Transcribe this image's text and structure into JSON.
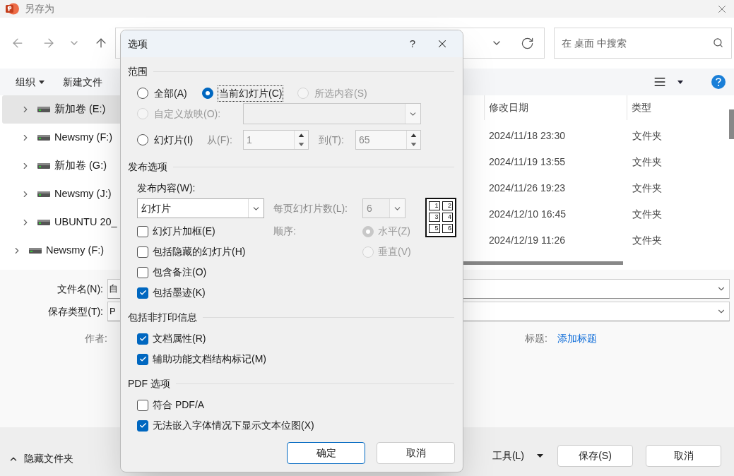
{
  "window": {
    "title": "另存为"
  },
  "navigation": {
    "search_placeholder": "在 桌面 中搜索"
  },
  "toolbar": {
    "organize": "组织",
    "new_folder": "新建文件"
  },
  "nav_pane": [
    {
      "label": "新加卷 (E:)",
      "kind": "child",
      "selected": true
    },
    {
      "label": "Newsmy (F:)",
      "kind": "child",
      "selected": false
    },
    {
      "label": "新加卷 (G:)",
      "kind": "child",
      "selected": false
    },
    {
      "label": "Newsmy (J:)",
      "kind": "child",
      "selected": false
    },
    {
      "label": "UBUNTU 20_",
      "kind": "child",
      "selected": false
    },
    {
      "label": "Newsmy (F:)",
      "kind": "top",
      "selected": false
    }
  ],
  "file_list": {
    "columns": [
      "修改日期",
      "类型"
    ],
    "rows": [
      [
        "2024/11/18 23:30",
        "文件夹"
      ],
      [
        "2024/11/19 13:55",
        "文件夹"
      ],
      [
        "2024/11/26 19:23",
        "文件夹"
      ],
      [
        "2024/12/10 16:45",
        "文件夹"
      ],
      [
        "2024/12/19 11:26",
        "文件夹"
      ]
    ]
  },
  "form": {
    "file_name_label": "文件名(N):",
    "file_name_value": "自",
    "save_type_label": "保存类型(T):",
    "save_type_value": "P",
    "author_label": "作者:",
    "title_label": "标题:",
    "title_link": "添加标题"
  },
  "footer": {
    "hide_folders": "隐藏文件夹",
    "tools": "工具(L)",
    "save": "保存(S)",
    "cancel": "取消"
  },
  "dialog": {
    "title": "选项",
    "help": "?",
    "range": {
      "heading": "范围",
      "options": [
        {
          "label": "全部(A)",
          "selected": false,
          "disabled": false,
          "focused": false
        },
        {
          "label": "当前幻灯片(C)",
          "selected": true,
          "disabled": false,
          "focused": true
        },
        {
          "label": "所选内容(S)",
          "selected": false,
          "disabled": true,
          "focused": false
        },
        {
          "label": "自定义放映(O):",
          "selected": false,
          "disabled": true,
          "focused": false
        },
        {
          "label": "幻灯片(I)",
          "selected": false,
          "disabled": false,
          "focused": false
        }
      ],
      "from_label": "从(F):",
      "from": "1",
      "to_label": "到(T):",
      "to": "65"
    },
    "publish": {
      "heading": "发布选项",
      "what_label": "发布内容(W):",
      "what_value": "幻灯片",
      "per_page_label": "每页幻灯片数(L):",
      "per_page_value": "6",
      "per_page_disabled": true,
      "order_label": "顺序:",
      "order_options": [
        {
          "label": "水平(Z)",
          "selected": true,
          "disabled": true
        },
        {
          "label": "垂直(V)",
          "selected": false,
          "disabled": true
        }
      ],
      "layout_numbers": [
        "1",
        "2",
        "3",
        "4",
        "5",
        "6"
      ],
      "checkboxes": [
        {
          "label": "幻灯片加框(E)",
          "checked": false
        },
        {
          "label": "包括隐藏的幻灯片(H)",
          "checked": false
        },
        {
          "label": "包含备注(O)",
          "checked": false
        },
        {
          "label": "包括墨迹(K)",
          "checked": true
        }
      ]
    },
    "non_print": {
      "heading": "包括非打印信息",
      "checkboxes": [
        {
          "label": "文档属性(R)",
          "checked": true
        },
        {
          "label": "辅助功能文档结构标记(M)",
          "checked": true
        }
      ]
    },
    "pdf": {
      "heading": "PDF 选项",
      "checkboxes": [
        {
          "label": "符合 PDF/A",
          "checked": false
        },
        {
          "label": "无法嵌入字体情况下显示文本位图(X)",
          "checked": true
        }
      ]
    },
    "buttons": [
      {
        "label": "确定",
        "primary": true
      },
      {
        "label": "取消",
        "primary": false
      }
    ]
  }
}
